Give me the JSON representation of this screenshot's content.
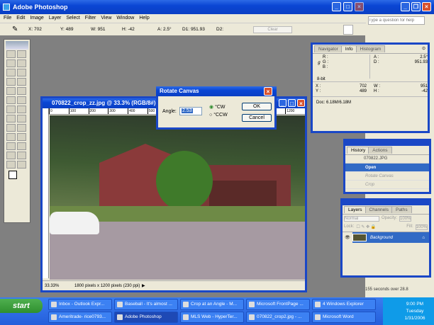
{
  "app": {
    "title": "Adobe Photoshop"
  },
  "menu": [
    "File",
    "Edit",
    "Image",
    "Layer",
    "Select",
    "Filter",
    "View",
    "Window",
    "Help"
  ],
  "options": {
    "x_label": "X:",
    "x": "702",
    "y_label": "Y:",
    "y": "489",
    "w_label": "W:",
    "w": "951",
    "h_label": "H:",
    "h": "-42",
    "a_label": "A:",
    "a": "2.5°",
    "d1_label": "D1:",
    "d1": "951.93",
    "d2_label": "D2:",
    "clear": "Clear"
  },
  "word": {
    "help_placeholder": "Type a question for help",
    "status": "155 seconds over 28.8"
  },
  "doc": {
    "title": "070822_crop_zz.jpg @ 33.3% (RGB/8#)",
    "zoom": "33.33%",
    "info": "1800 pixels x 1200 pixels (230 ppi)",
    "ruler": [
      "0",
      "100",
      "200",
      "300",
      "400",
      "500",
      "600",
      "700",
      "800",
      "900",
      "1000",
      "1100",
      "1200"
    ]
  },
  "dialog": {
    "title": "Rotate Canvas",
    "angle_label": "Angle:",
    "angle_value": "2.53",
    "cw": "°CW",
    "ccw": "°CCW",
    "selected": "cw",
    "ok": "OK",
    "cancel": "Cancel"
  },
  "info": {
    "tabs": [
      "Navigator",
      "Info",
      "Histogram"
    ],
    "active_tab": "Info",
    "r": "R :",
    "g": "G :",
    "b": "B :",
    "bit": "8-bit",
    "a_label": "A :",
    "a": "2.5°",
    "d_label": "D :",
    "d": "951.93",
    "x_label": "X :",
    "x": "702",
    "y_label": "Y :",
    "y": "489",
    "w_label": "W :",
    "w": "951",
    "h_label": "H :",
    "h": "-42",
    "doc": "Doc: 6.18M/6.18M"
  },
  "history": {
    "tabs": [
      "History",
      "Actions"
    ],
    "snapshot": "070822.JPG",
    "items": [
      "Open",
      "Rotate Canvas",
      "Crop"
    ],
    "active": "Open"
  },
  "layers": {
    "tabs": [
      "Layers",
      "Channels",
      "Paths"
    ],
    "mode": "Normal",
    "opacity_label": "Opacity:",
    "opacity": "100%",
    "lock_label": "Lock:",
    "fill_label": "Fill:",
    "fill": "100%",
    "layer": "Background"
  },
  "taskbar": {
    "start": "start",
    "tasks": [
      "Inbox - Outlook Expr...",
      "Baseball - It's almost ...",
      "Crop at an Angle - M...",
      "Microsoft FrontPage ...",
      "4 Windows Explorer",
      "Ameritrade- rice0793...",
      "Adobe Photoshop",
      "MLS Web - HyperTer...",
      "070822_crop2.jpg - ...",
      "Microsoft Word"
    ],
    "active": "Adobe Photoshop",
    "time": "9:00 PM",
    "day": "Tuesday",
    "date": "1/31/2006"
  }
}
